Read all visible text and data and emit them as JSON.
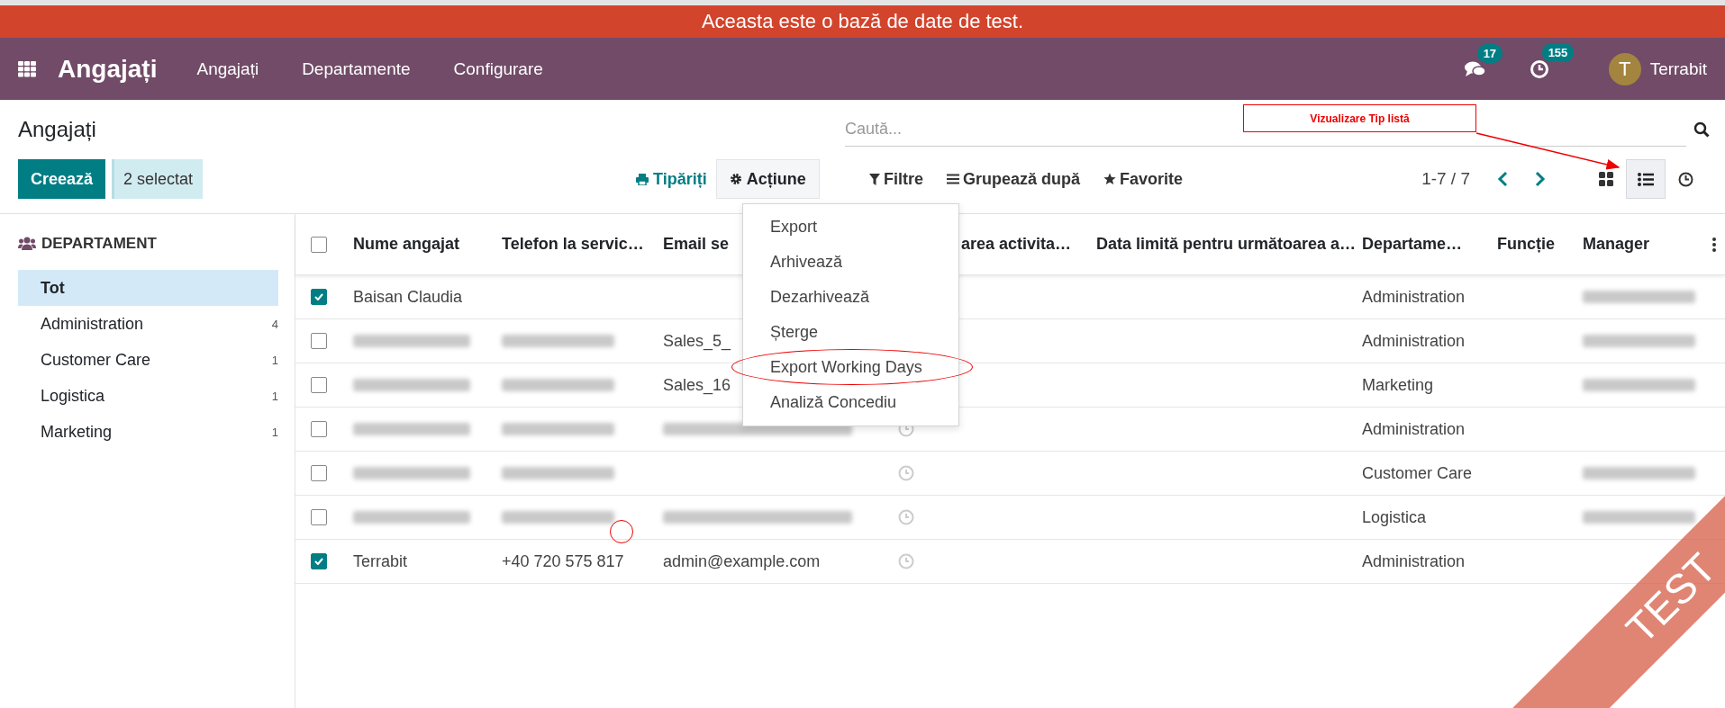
{
  "banner": {
    "text": "Aceasta este o bază de date de test."
  },
  "navbar": {
    "app_title": "Angajați",
    "menu": [
      "Angajați",
      "Departamente",
      "Configurare"
    ],
    "messages_badge": "17",
    "activities_badge": "155",
    "user": {
      "initial": "T",
      "name": "Terrabit"
    }
  },
  "control_panel": {
    "title": "Angajați",
    "search": {
      "placeholder": "Caută..."
    },
    "create_button": "Creează",
    "selection": "2 selectat",
    "print": "Tipăriți",
    "action": {
      "label": "Acțiune",
      "expanded": true
    },
    "filters": "Filtre",
    "group_by": "Grupează după",
    "favorites": "Favorite",
    "pager": "1-7 / 7",
    "views": [
      {
        "kind": "kanban",
        "selected": false
      },
      {
        "kind": "list",
        "selected": true
      },
      {
        "kind": "activity",
        "selected": false
      }
    ]
  },
  "action_menu": [
    {
      "label": "Export",
      "circled": false
    },
    {
      "label": "Arhivează",
      "circled": false
    },
    {
      "label": "Dezarhivează",
      "circled": false
    },
    {
      "label": "Șterge",
      "circled": false
    },
    {
      "label": "Export Working Days",
      "circled": true
    },
    {
      "label": "Analiză Concediu",
      "circled": false
    }
  ],
  "sidebar": {
    "title": "DEPARTAMENT",
    "items": [
      {
        "label": "Tot",
        "selected": true
      },
      {
        "label": "Administration",
        "count": "4",
        "selected": false
      },
      {
        "label": "Customer Care",
        "count": "1",
        "selected": false
      },
      {
        "label": "Logistica",
        "count": "1",
        "selected": false
      },
      {
        "label": "Marketing",
        "count": "1",
        "selected": false
      }
    ]
  },
  "table": {
    "all_selected": false,
    "columns": [
      "Nume angajat",
      "Telefon la servic…",
      "Email se",
      "area activita…",
      "Data limită pentru următoarea a…",
      "Departame…",
      "Funcție",
      "Manager"
    ],
    "rows": [
      {
        "selected": true,
        "click_marker": false,
        "cells": [
          {
            "kind": "text",
            "text": "Baisan Claudia"
          },
          {
            "kind": "empty"
          },
          {
            "kind": "empty"
          },
          {
            "kind": "empty"
          },
          {
            "kind": "empty"
          },
          {
            "kind": "text",
            "text": "Administration"
          },
          {
            "kind": "empty"
          },
          {
            "kind": "redacted"
          }
        ]
      },
      {
        "selected": false,
        "click_marker": false,
        "cells": [
          {
            "kind": "redacted"
          },
          {
            "kind": "redacted"
          },
          {
            "kind": "text",
            "text": "Sales_5_"
          },
          {
            "kind": "empty"
          },
          {
            "kind": "empty"
          },
          {
            "kind": "text",
            "text": "Administration"
          },
          {
            "kind": "empty"
          },
          {
            "kind": "redacted"
          }
        ]
      },
      {
        "selected": false,
        "click_marker": false,
        "cells": [
          {
            "kind": "redacted"
          },
          {
            "kind": "redacted"
          },
          {
            "kind": "text",
            "text": "Sales_16"
          },
          {
            "kind": "empty"
          },
          {
            "kind": "empty"
          },
          {
            "kind": "text",
            "text": "Marketing"
          },
          {
            "kind": "empty"
          },
          {
            "kind": "redacted"
          }
        ]
      },
      {
        "selected": false,
        "click_marker": false,
        "cells": [
          {
            "kind": "redacted"
          },
          {
            "kind": "redacted"
          },
          {
            "kind": "redacted"
          },
          {
            "kind": "activity"
          },
          {
            "kind": "empty"
          },
          {
            "kind": "text",
            "text": "Administration"
          },
          {
            "kind": "empty"
          },
          {
            "kind": "empty"
          }
        ]
      },
      {
        "selected": false,
        "click_marker": false,
        "cells": [
          {
            "kind": "redacted"
          },
          {
            "kind": "redacted"
          },
          {
            "kind": "empty"
          },
          {
            "kind": "activity"
          },
          {
            "kind": "empty"
          },
          {
            "kind": "text",
            "text": "Customer Care"
          },
          {
            "kind": "empty"
          },
          {
            "kind": "redacted"
          }
        ]
      },
      {
        "selected": false,
        "click_marker": true,
        "cells": [
          {
            "kind": "redacted"
          },
          {
            "kind": "redacted"
          },
          {
            "kind": "redacted"
          },
          {
            "kind": "activity"
          },
          {
            "kind": "empty"
          },
          {
            "kind": "text",
            "text": "Logistica"
          },
          {
            "kind": "empty"
          },
          {
            "kind": "redacted"
          }
        ]
      },
      {
        "selected": true,
        "click_marker": false,
        "cells": [
          {
            "kind": "text",
            "text": "Terrabit"
          },
          {
            "kind": "text",
            "text": "+40 720 575 817"
          },
          {
            "kind": "text",
            "text": "admin@example.com"
          },
          {
            "kind": "activity"
          },
          {
            "kind": "empty"
          },
          {
            "kind": "text",
            "text": "Administration"
          },
          {
            "kind": "empty"
          },
          {
            "kind": "empty"
          }
        ]
      }
    ]
  },
  "annotations": {
    "callout": "Vizualizare Tip listă"
  },
  "ribbon": "TEST"
}
